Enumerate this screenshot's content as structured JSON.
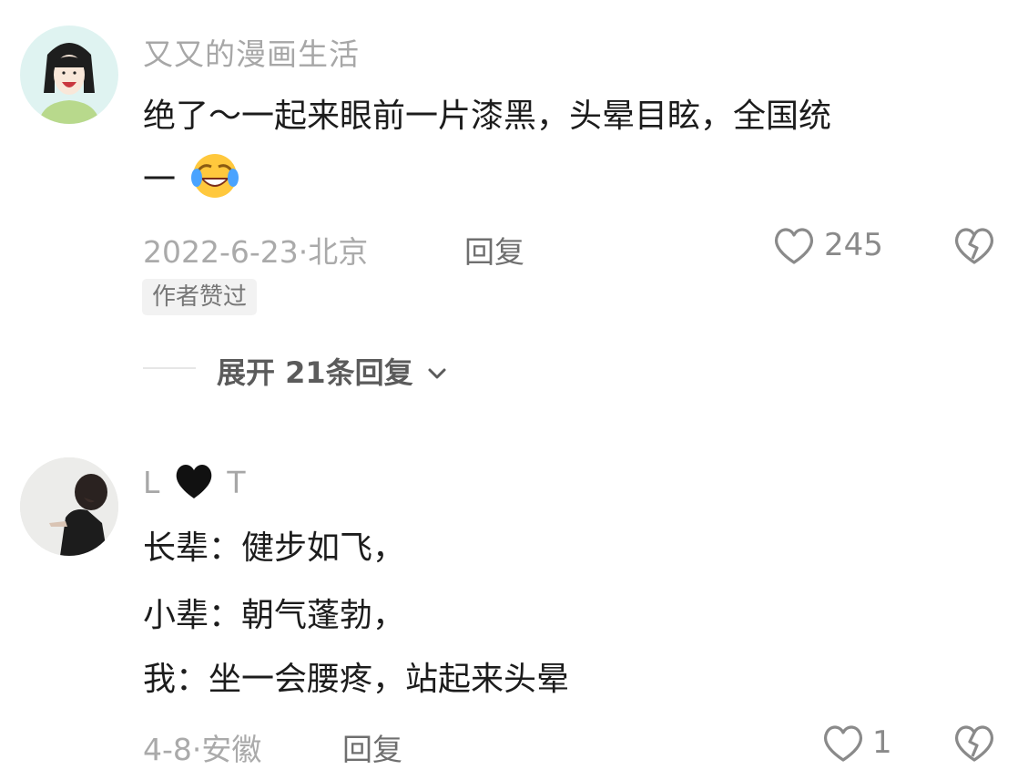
{
  "comments": [
    {
      "username": "又又的漫画生活",
      "content_lines": [
        "绝了～一起来眼前一片漆黑，头晕目眩，全国统",
        "一"
      ],
      "emoji": "laughing-tears-emoji",
      "date": "2022-6-23",
      "location": "北京",
      "reply_label": "回复",
      "likes": "245",
      "author_liked_tag": "作者赞过",
      "expand_label": "展开 21条回复"
    },
    {
      "username_parts": [
        "L",
        "T"
      ],
      "username_icon": "black-heart-icon",
      "content_lines": [
        "长辈：健步如飞，",
        "小辈：朝气蓬勃，",
        "我：坐一会腰疼，站起来头晕"
      ],
      "date": "4-8",
      "location": "安徽",
      "reply_label": "回复",
      "likes": "1"
    }
  ],
  "icons": {
    "like": "heart-outline-icon",
    "dislike": "broken-heart-icon",
    "expand": "chevron-down-icon"
  }
}
